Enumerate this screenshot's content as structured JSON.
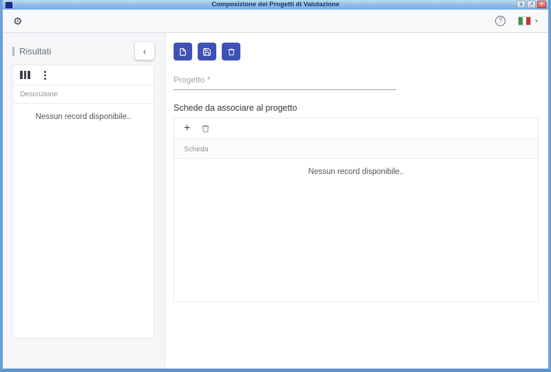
{
  "window": {
    "title": "Composizione dei Progetti di Valutazione",
    "controls": {
      "minimize_glyph": "∨",
      "maximize_glyph": "↗",
      "close_glyph": "×"
    }
  },
  "toolbar": {
    "settings_glyph": "⚙",
    "help_glyph": "?",
    "language_caret_glyph": "▾",
    "language_flag": "italian-flag"
  },
  "left_panel": {
    "title": "Risultati",
    "collapse_glyph": "‹",
    "table": {
      "column_header": "Descrizione",
      "empty_text": "Nessun record disponibile.."
    }
  },
  "right_panel": {
    "actions": [
      {
        "name": "new-record",
        "icon": "file-icon"
      },
      {
        "name": "save-record",
        "icon": "save-icon"
      },
      {
        "name": "delete-record",
        "icon": "trash-icon"
      }
    ],
    "project_field": {
      "placeholder": "Progetto *"
    },
    "section_title": "Schede da associare al progetto",
    "assoc_toolbar": {
      "add_glyph": "+",
      "remove_icon": "trash-icon"
    },
    "table": {
      "column_header": "Scheda",
      "empty_text": "Nessun record disponibile.."
    }
  },
  "colors": {
    "accent": "#3f51b5",
    "titlebar_top": "#bddaf2",
    "titlebar_bottom": "#79ade0",
    "window_border": "#6ba0d3",
    "flag_green": "#3d9448",
    "flag_red": "#cd342e"
  }
}
